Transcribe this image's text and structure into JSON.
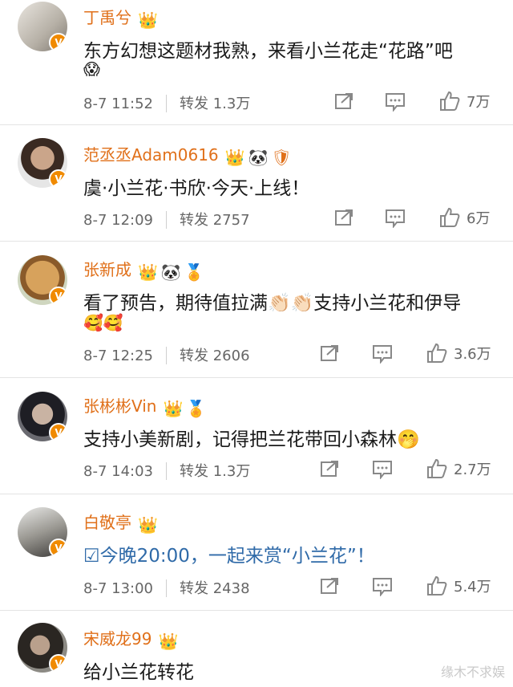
{
  "comments": [
    {
      "name": "丁禹兮",
      "crown": "👑",
      "badges": [],
      "text": "东方幻想这题材我熟，来看小兰花走“花路”吧",
      "emoji_line": "😱",
      "time": "8-7 11:52",
      "repost_label": "转发",
      "repost": "1.3万",
      "likes": "7万"
    },
    {
      "name": "范丞丞Adam0616",
      "crown": "👑",
      "badges": [
        "🐼",
        "🛡"
      ],
      "text": "虞·小兰花·书欣·今天·上线！",
      "emoji_line": "",
      "time": "8-7 12:09",
      "repost_label": "转发",
      "repost": "2757",
      "likes": "6万"
    },
    {
      "name": "张新成",
      "crown": "👑",
      "badges": [
        "🐼",
        "🏅"
      ],
      "text": "看了预告，期待值拉满👏🏻👏🏻支持小兰花和伊导",
      "emoji_line": "🥰🥰",
      "time": "8-7 12:25",
      "repost_label": "转发",
      "repost": "2606",
      "likes": "3.6万"
    },
    {
      "name": "张彬彬Vin",
      "crown": "👑",
      "badges": [
        "🏅"
      ],
      "text": "支持小美新剧，记得把兰花带回小森林🤭",
      "emoji_line": "",
      "time": "8-7 14:03",
      "repost_label": "转发",
      "repost": "1.3万",
      "likes": "2.7万"
    },
    {
      "name": "白敬亭",
      "crown": "👑",
      "badges": [],
      "text": "今晚20:00，一起来赏“小兰花”！",
      "emoji_line": "",
      "time": "8-7 13:00",
      "repost_label": "转发",
      "repost": "2438",
      "likes": "5.4万"
    },
    {
      "name": "宋威龙99",
      "crown": "👑",
      "badges": [],
      "text": "给小兰花转花",
      "emoji_line": "",
      "time": "",
      "repost_label": "",
      "repost": "",
      "likes": ""
    }
  ],
  "calendar_icon": "☑",
  "watermark": "缘木不求娱",
  "colors": {
    "name": "#e0701a",
    "verified": "#f08a00",
    "meta": "#666666",
    "link_blue": "#2f6aa8"
  }
}
